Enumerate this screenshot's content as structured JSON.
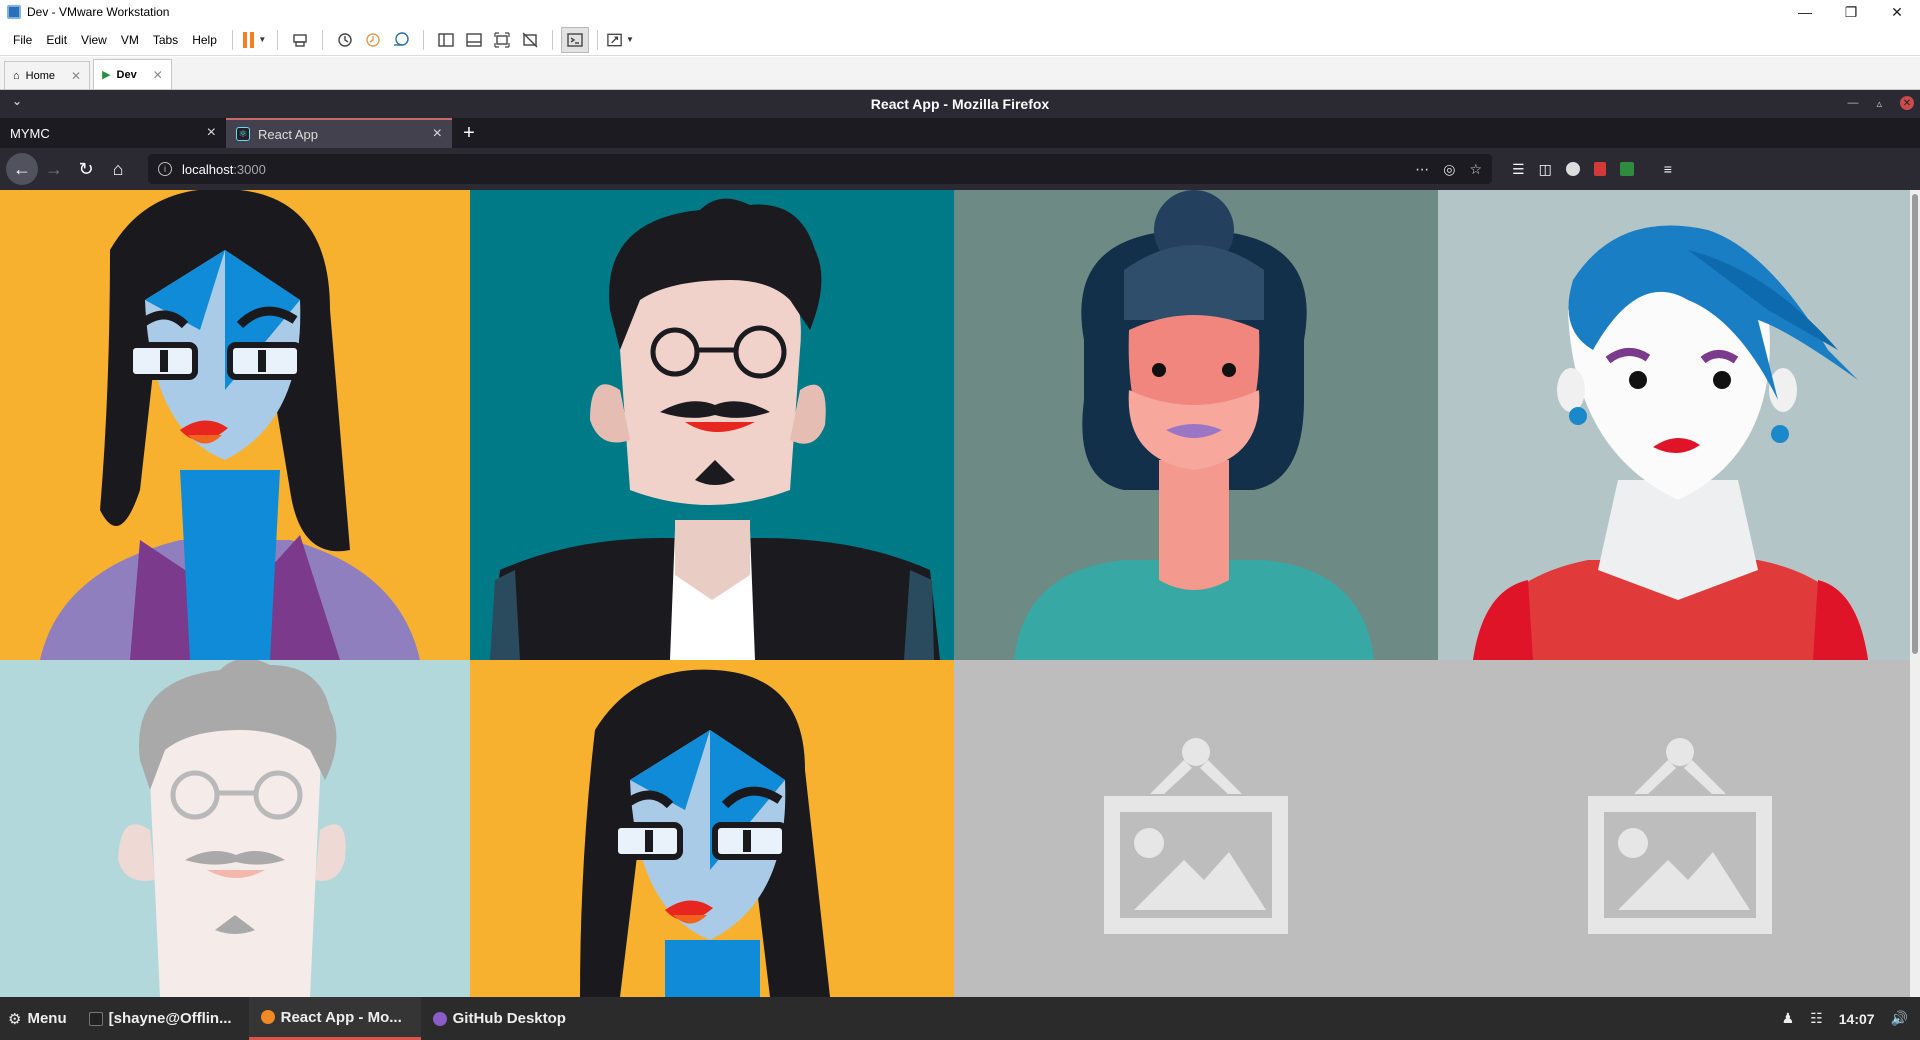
{
  "vmware": {
    "title": "Dev - VMware Workstation",
    "menu": [
      "File",
      "Edit",
      "View",
      "VM",
      "Tabs",
      "Help"
    ],
    "tabs": [
      {
        "label": "Home",
        "active": false
      },
      {
        "label": "Dev",
        "active": true
      }
    ]
  },
  "firefox": {
    "window_title": "React App - Mozilla Firefox",
    "tabs": [
      {
        "label": "MYMC",
        "active": false
      },
      {
        "label": "React App",
        "active": true
      }
    ],
    "url_host": "localhost",
    "url_port": ":3000"
  },
  "grid": {
    "tiles": [
      {
        "kind": "avatar",
        "style": "blue-woman-glasses",
        "bg": "#f7b12e"
      },
      {
        "kind": "avatar",
        "style": "man-glasses-mustache",
        "bg": "#007a87"
      },
      {
        "kind": "avatar",
        "style": "woman-bun",
        "bg": "#6e8a85"
      },
      {
        "kind": "avatar",
        "style": "woman-blue-hair",
        "bg": "#b4c5c8"
      },
      {
        "kind": "avatar",
        "style": "faded-man-glasses",
        "bg": "#b2d8db"
      },
      {
        "kind": "avatar",
        "style": "blue-woman-glasses",
        "bg": "#f7b12e"
      },
      {
        "kind": "placeholder",
        "icon": "image-placeholder-icon",
        "bg": "#bdbdbd"
      },
      {
        "kind": "placeholder",
        "icon": "image-placeholder-icon",
        "bg": "#bdbdbd"
      }
    ]
  },
  "taskbar": {
    "menu_label": "Menu",
    "items": [
      {
        "label": "[shayne@Offlin...",
        "active": false
      },
      {
        "label": "React App - Mo...",
        "active": true
      },
      {
        "label": "GitHub Desktop",
        "active": false
      }
    ],
    "clock": "14:07"
  }
}
